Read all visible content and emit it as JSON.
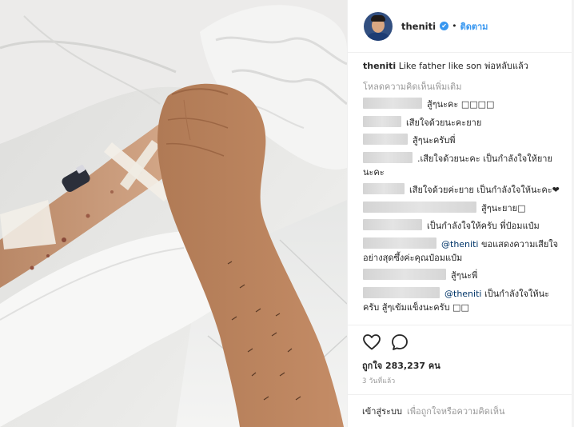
{
  "post": {
    "username": "theniti",
    "verified_glyph": "✔",
    "separator": "•",
    "follow_label": "ติดตาม",
    "caption_text": "Like father like son พ่อหลับแล้ว",
    "load_more_label": "โหลดความคิดเห็นเพิ่มเติม",
    "comments": [
      {
        "user_width": 74,
        "text": "สู้ๆนะคะ □□□□"
      },
      {
        "user_width": 48,
        "text": "เสียใจด้วยนะคะยาย"
      },
      {
        "user_width": 56,
        "text": "สู้ๆนะครับพี่"
      },
      {
        "user_width": 62,
        "text": ".เสียใจด้วยนะคะ เป็นกำลังใจให้ยายนะคะ"
      },
      {
        "user_width": 52,
        "text": "เสียใจด้วยค่ะยาย เป็นกำลังใจให้นะคะ❤"
      },
      {
        "user_width": 142,
        "text": "สู้ๆนะยาย□"
      },
      {
        "user_width": 74,
        "text": "เป็นกำลังใจให้ครับ พี่ป๋อมแป๋ม"
      },
      {
        "user_width": 92,
        "mention": "@theniti",
        "text": "ขอแสดงความเสียใจอย่างสุดซึ้งค่ะคุณป๋อมแป๋ม"
      },
      {
        "user_width": 104,
        "text": "สู้ๆนะพี่"
      },
      {
        "user_width": 96,
        "mention": "@theniti",
        "text": "เป็นกำลังใจให้นะครับ สู้ๆเข้มแข็งนะครับ □□"
      }
    ],
    "likes_label": "ถูกใจ 283,237 คน",
    "timestamp": "3 วันที่แล้ว",
    "login_label": "เข้าสู่ระบบ",
    "login_rest": "เพื่อถูกใจหรือความคิดเห็น"
  },
  "icons": {
    "like": "heart-icon",
    "comment": "comment-icon",
    "verified": "verified-badge-icon"
  },
  "colors": {
    "link_blue": "#3897f0",
    "muted": "#999999",
    "text": "#262626",
    "border": "#efefef"
  }
}
